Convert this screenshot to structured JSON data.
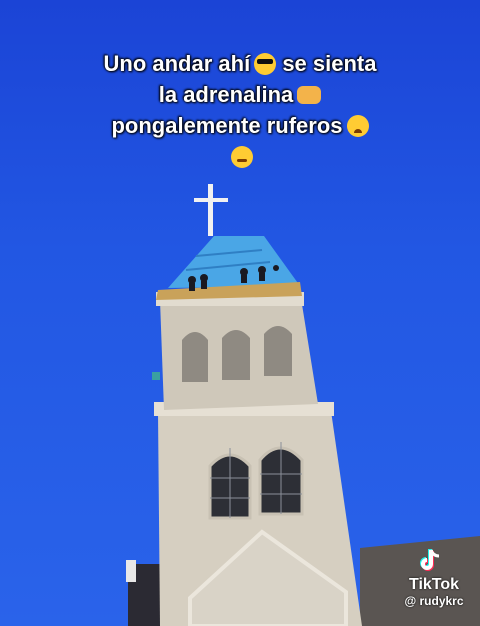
{
  "caption": {
    "line1": "Uno andar ahí",
    "line1b": "se sienta",
    "line2": "la adrenalina",
    "line3": "pongalemente ruferos",
    "emojis": [
      "smiling-face-with-sunglasses",
      "backhand-index-pointing-left",
      "face-exhaling",
      "woozy-face"
    ]
  },
  "watermark": {
    "brand": "TikTok",
    "user": "@ rudykrc"
  },
  "colors": {
    "sky": "#2257e3",
    "tower": "#d9d2c4",
    "roof": "#4aa6e6"
  }
}
